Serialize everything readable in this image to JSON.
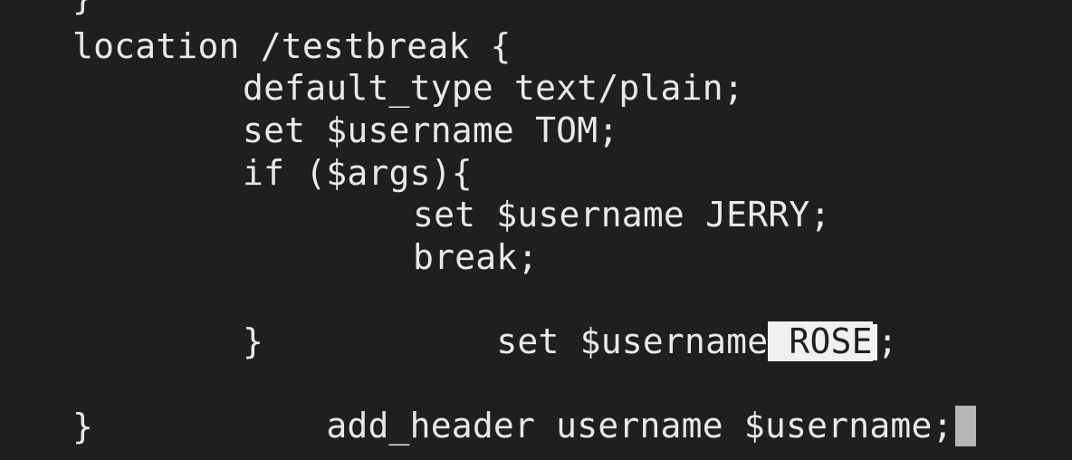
{
  "editor": {
    "lines": [
      "}",
      "location /testbreak {",
      "default_type text/plain;",
      "set $username TOM;",
      "if ($args){",
      "set $username JERRY;",
      "break;",
      "set $username",
      "}",
      "add_header username $username;",
      "}"
    ],
    "selected_text": " ROSE",
    "after_selection": ";"
  }
}
